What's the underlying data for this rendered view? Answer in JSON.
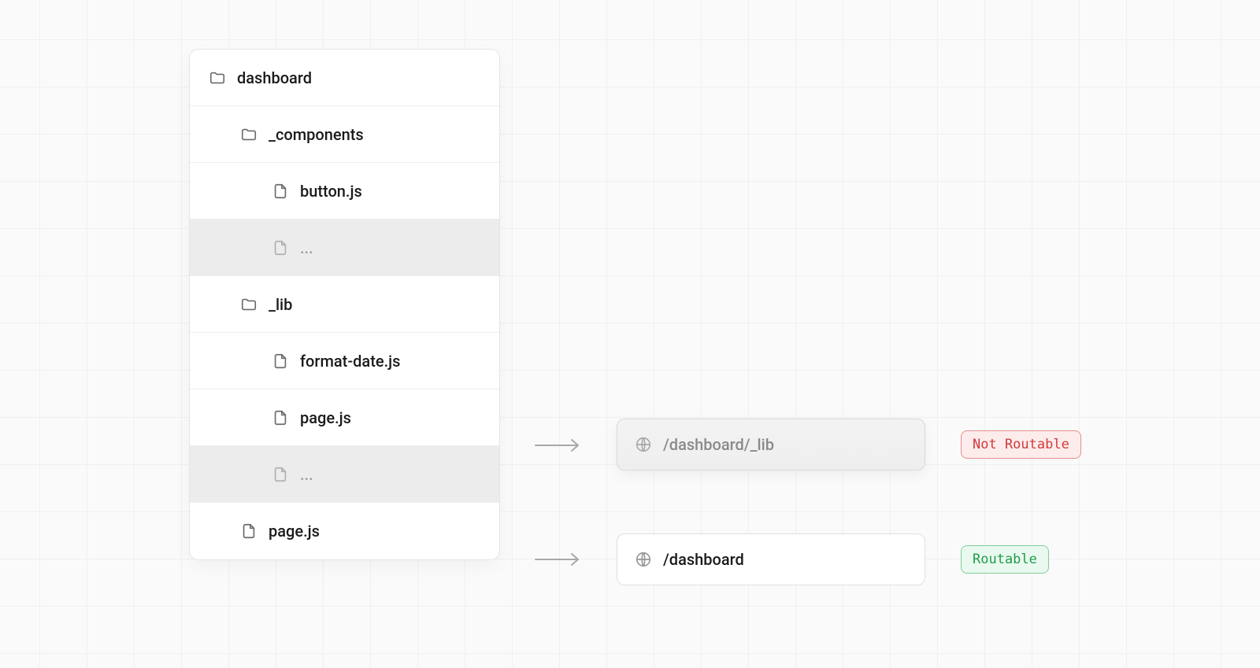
{
  "tree": {
    "root": "dashboard",
    "components_folder": "_components",
    "components_file": "button.js",
    "components_more": "...",
    "lib_folder": "_lib",
    "lib_file1": "format-date.js",
    "lib_file2": "page.js",
    "lib_more": "...",
    "root_page": "page.js"
  },
  "routes": {
    "not_routable": {
      "path": "/dashboard/_lib",
      "badge": "Not Routable"
    },
    "routable": {
      "path": "/dashboard",
      "badge": "Routable"
    }
  }
}
